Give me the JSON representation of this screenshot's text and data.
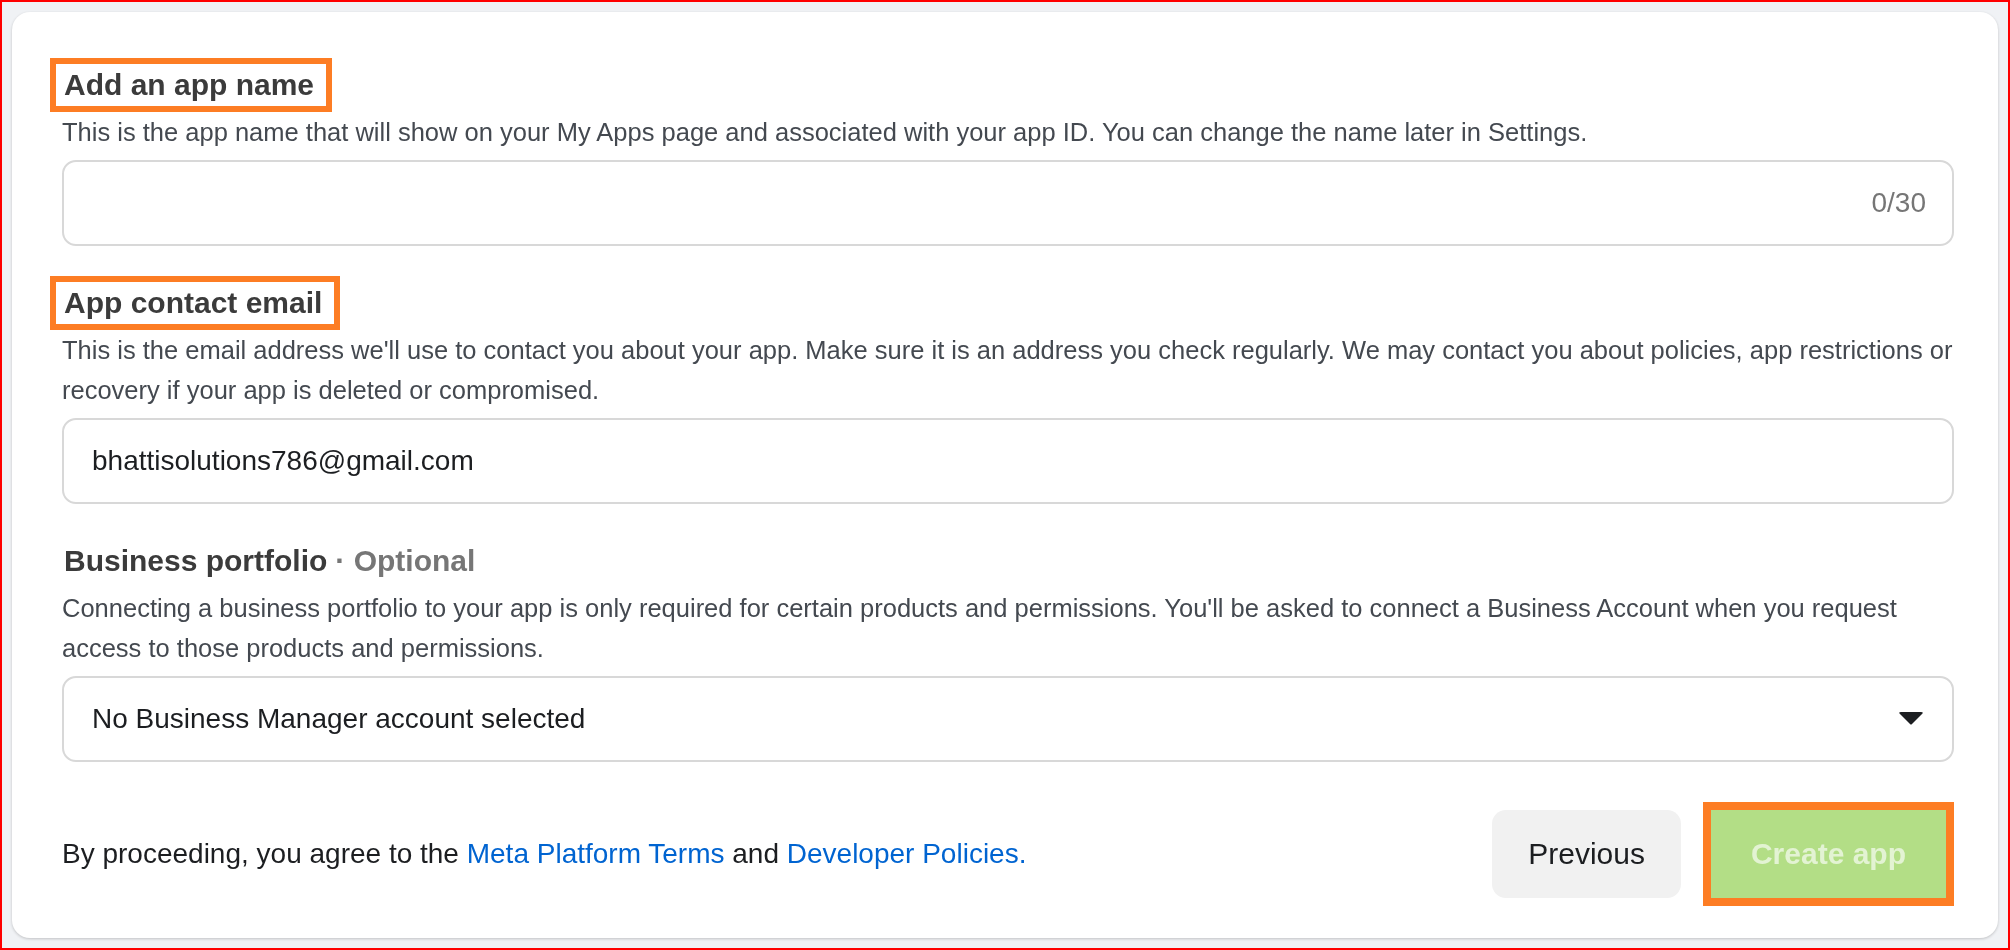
{
  "sections": [
    {
      "kind": "text-input",
      "title": "Add an app name",
      "highlighted": true,
      "description": "This is the app name that will show on your My Apps page and associated with your app ID. You can change the name later in Settings.",
      "counter": "0/30"
    },
    {
      "kind": "text-input",
      "title": "App contact email",
      "highlighted": true,
      "description": "This is the email address we'll use to contact you about your app. Make sure it is an address you check regularly. We may contact you about policies, app restrictions or recovery if your app is deleted or compromised.",
      "value": "bhattisolutions786@gmail.com"
    },
    {
      "kind": "dropdown",
      "title": "Business portfolio",
      "optional_label": "· Optional",
      "highlighted": false,
      "description": "Connecting a business portfolio to your app is only required for certain products and permissions. You'll be asked to connect a Business Account when you request access to those products and permissions.",
      "value": "No Business Manager account selected"
    }
  ],
  "consent": [
    {
      "kind": "text",
      "text": "By proceeding, you agree to the"
    },
    {
      "kind": "link",
      "text": "Meta Platform Terms"
    },
    {
      "kind": "text",
      "text": "and"
    },
    {
      "kind": "link",
      "text": "Developer Policies."
    }
  ],
  "buttons": [
    {
      "kind": "secondary",
      "label": "Previous",
      "disabled": false,
      "highlighted": false
    },
    {
      "kind": "primary",
      "label": "Create app",
      "disabled": true,
      "highlighted": true
    }
  ]
}
